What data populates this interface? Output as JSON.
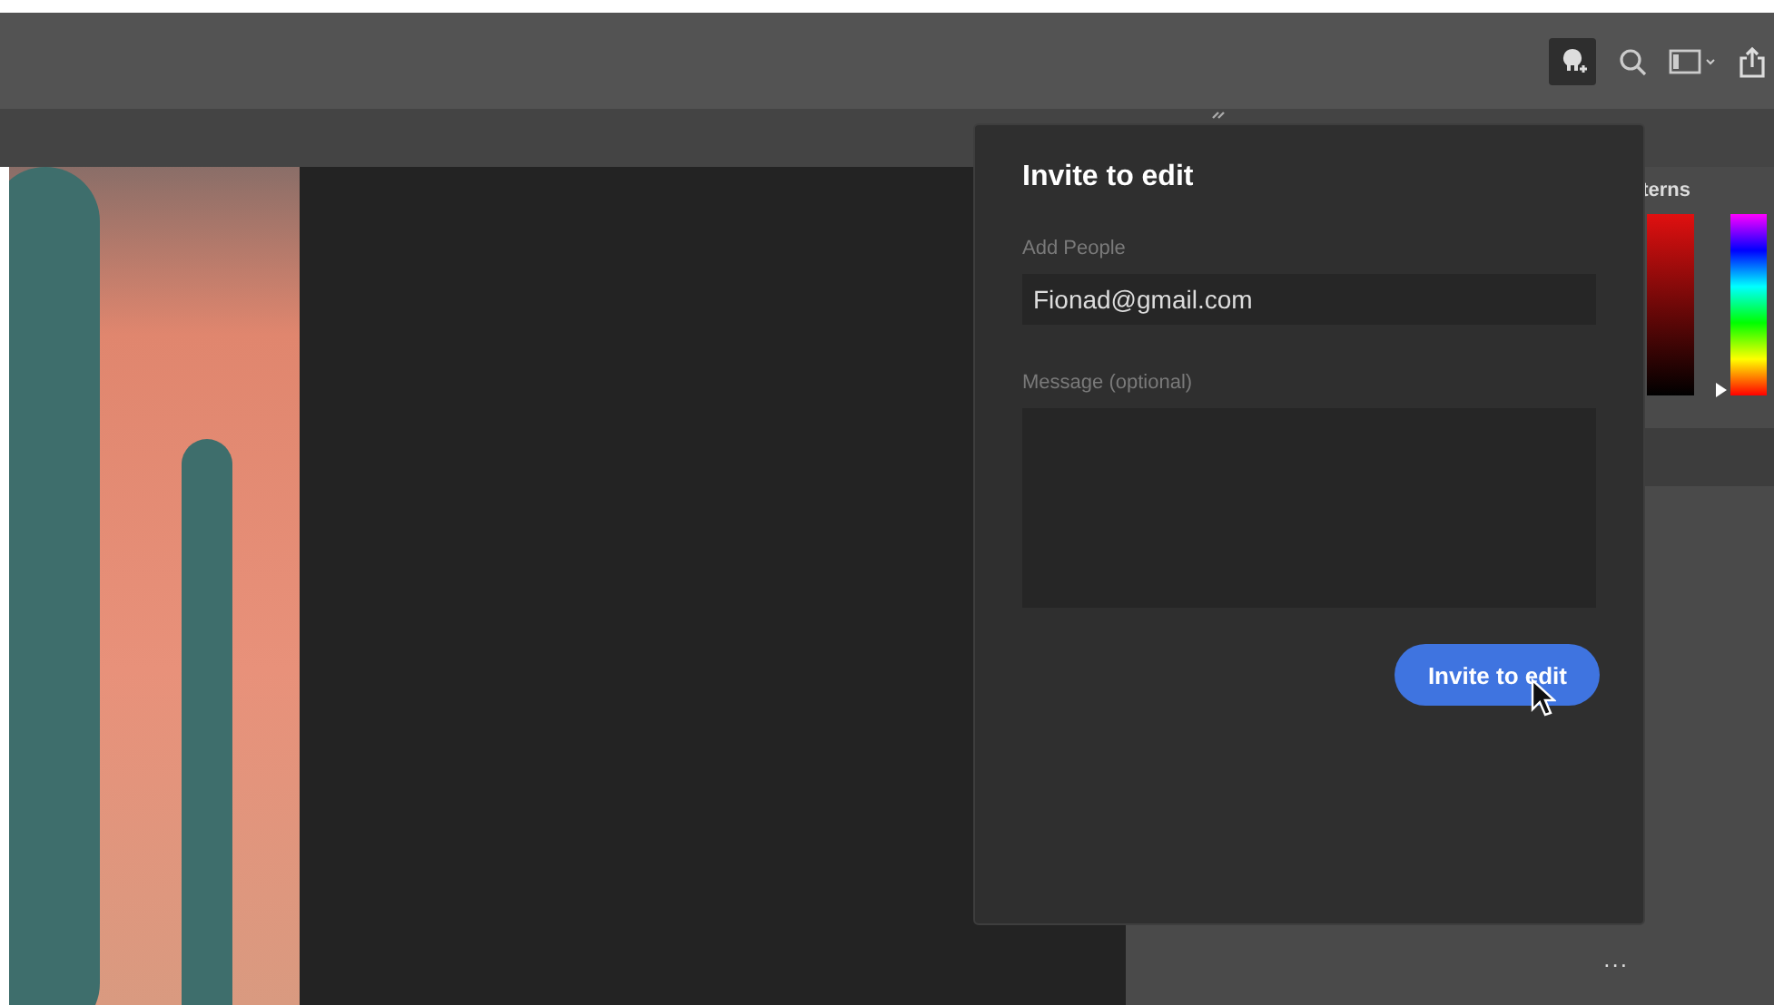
{
  "panel": {
    "tab": "terns",
    "more": "...",
    "hue": {
      "level": 0.03
    }
  },
  "invite_popover": {
    "title": "Invite to edit",
    "people_label": "Add People",
    "people_value": "Fionad@gmail.com",
    "message_label": "Message (optional)",
    "button": "Invite to edit"
  }
}
